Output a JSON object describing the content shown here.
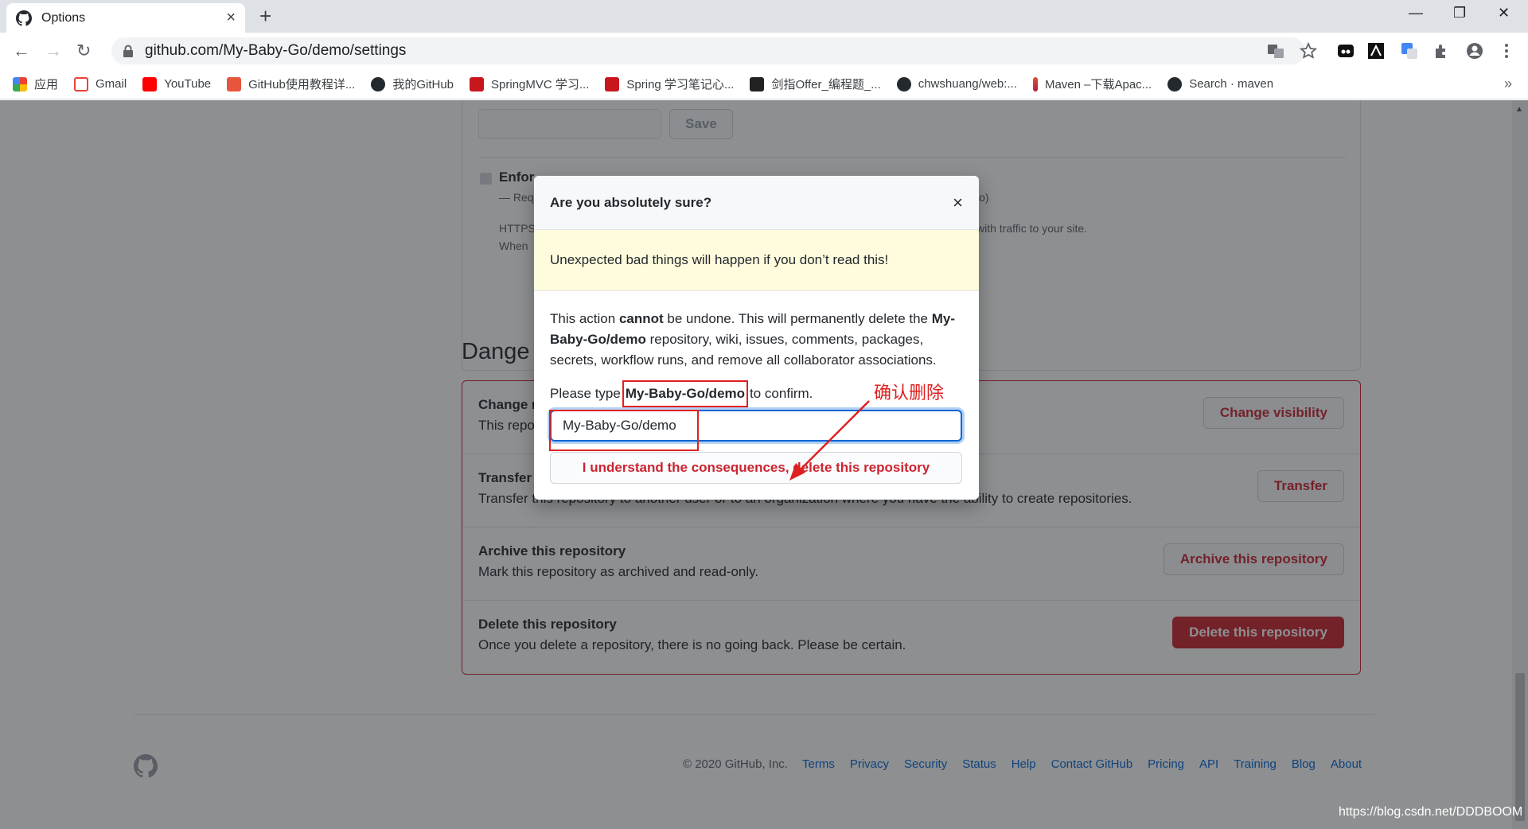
{
  "browser": {
    "tab_title": "Options",
    "url": "github.com/My-Baby-Go/demo/settings",
    "bookmarks": [
      {
        "label": "应用",
        "color": "#4285f4"
      },
      {
        "label": "Gmail",
        "color": "#ea4335"
      },
      {
        "label": "YouTube",
        "color": "#ff0000"
      },
      {
        "label": "GitHub使用教程详...",
        "color": "#e8553d"
      },
      {
        "label": "我的GitHub",
        "color": "#24292e"
      },
      {
        "label": "SpringMVC 学习...",
        "color": "#c8161d"
      },
      {
        "label": "Spring 学习笔记心...",
        "color": "#c8161d"
      },
      {
        "label": "剑指Offer_编程题_...",
        "color": "#222222"
      },
      {
        "label": "chwshuang/web:...",
        "color": "#24292e"
      },
      {
        "label": "Maven –下载Apac...",
        "color": "#e35b2a"
      },
      {
        "label": "Search · maven",
        "color": "#24292e"
      }
    ],
    "more": "»"
  },
  "pages_section": {
    "save_label": "Save",
    "enforce_label": "Enfor",
    "enforce_sub_left": "— Req",
    "enforce_sub_right": "io)",
    "https_note_left": "HTTPS",
    "https_note_right": "with traffic to your site.",
    "when_note": "When"
  },
  "danger_zone": {
    "title": "Dange",
    "rows": [
      {
        "heading": "Change r",
        "desc": "This repo",
        "button": "Change visibility"
      },
      {
        "heading": "Transfer",
        "desc": "Transfer this repository to another user or to an organization where you have the ability to create repositories.",
        "button": "Transfer"
      },
      {
        "heading": "Archive this repository",
        "desc": "Mark this repository as archived and read-only.",
        "button": "Archive this repository"
      },
      {
        "heading": "Delete this repository",
        "desc": "Once you delete a repository, there is no going back. Please be certain.",
        "button": "Delete this repository"
      }
    ]
  },
  "footer": {
    "copyright": "© 2020 GitHub, Inc.",
    "links": [
      "Terms",
      "Privacy",
      "Security",
      "Status",
      "Help",
      "Contact GitHub",
      "Pricing",
      "API",
      "Training",
      "Blog",
      "About"
    ]
  },
  "modal": {
    "title": "Are you absolutely sure?",
    "close": "×",
    "warning": "Unexpected bad things will happen if you don’t read this!",
    "body_pre": "This action ",
    "body_bold": "cannot",
    "body_mid": " be undone. This will permanently delete the ",
    "body_repo": "My-Baby-Go/demo",
    "body_post": " repository, wiki, issues, comments, packages, secrets, workflow runs, and remove all collaborator associations.",
    "confirm_pre": "Please type",
    "confirm_code": "My-Baby-Go/demo",
    "confirm_post": "to confirm.",
    "input_value": "My-Baby-Go/demo",
    "submit": "I understand the consequences, delete this repository"
  },
  "annotation": "确认删除",
  "watermark": "https://blog.csdn.net/DDDBOOM"
}
